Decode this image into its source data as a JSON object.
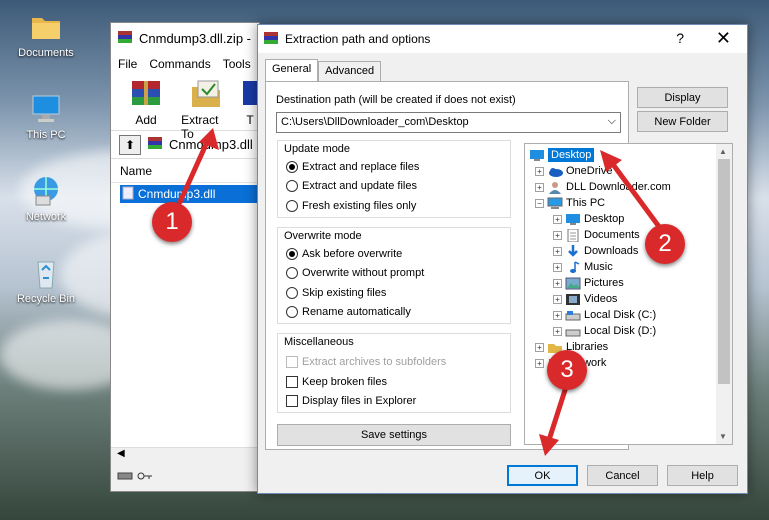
{
  "desktop": {
    "icons": [
      {
        "label": "Documents",
        "icon": "folder-icon"
      },
      {
        "label": "This PC",
        "icon": "computer-icon"
      },
      {
        "label": "Network",
        "icon": "network-icon"
      },
      {
        "label": "Recycle Bin",
        "icon": "recycle-bin-icon"
      }
    ]
  },
  "winrar": {
    "title": "Cnmdump3.dll.zip -",
    "menu": [
      "File",
      "Commands",
      "Tools"
    ],
    "toolbar": {
      "add": "Add",
      "extract": "Extract To",
      "third": "T"
    },
    "address": "Cnmdump3.dll",
    "column_name": "Name",
    "file_row": "Cnmdump3.dll"
  },
  "dialog": {
    "title": "Extraction path and options",
    "help": "?",
    "close": "✕",
    "tabs": [
      "General",
      "Advanced"
    ],
    "dest_label": "Destination path (will be created if does not exist)",
    "dest_value": "C:\\Users\\DllDownloader_com\\Desktop",
    "update_mode": {
      "title": "Update mode",
      "options": [
        "Extract and replace files",
        "Extract and update files",
        "Fresh existing files only"
      ]
    },
    "overwrite_mode": {
      "title": "Overwrite mode",
      "options": [
        "Ask before overwrite",
        "Overwrite without prompt",
        "Skip existing files",
        "Rename automatically"
      ]
    },
    "misc": {
      "title": "Miscellaneous",
      "options": [
        "Extract archives to subfolders",
        "Keep broken files",
        "Display files in Explorer"
      ]
    },
    "save_settings": "Save settings",
    "buttons": {
      "display": "Display",
      "new_folder": "New Folder",
      "ok": "OK",
      "cancel": "Cancel",
      "help": "Help"
    },
    "tree": [
      "Desktop",
      "OneDrive",
      "DLL Downloader.com",
      "This PC",
      "Desktop",
      "Documents",
      "Downloads",
      "Music",
      "Pictures",
      "Videos",
      "Local Disk (C:)",
      "Local Disk (D:)",
      "Libraries",
      "Network"
    ]
  },
  "annotations": [
    "1",
    "2",
    "3"
  ],
  "colors": {
    "accent": "#0078d7",
    "annotation": "#d9292b",
    "selection": "#0a70d8"
  }
}
